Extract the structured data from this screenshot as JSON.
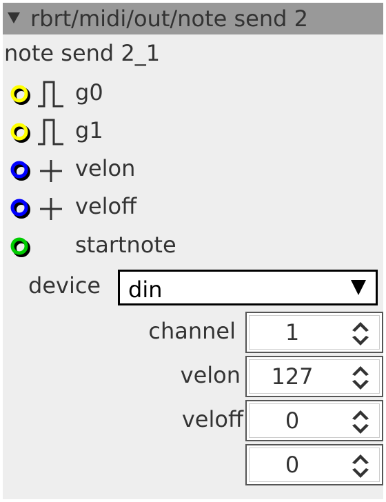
{
  "header": {
    "title": "rbrt/midi/out/note send 2",
    "collapse_icon": "triangle-down-icon"
  },
  "instance_name": "note send 2_1",
  "inlets": [
    {
      "label": "g0",
      "ring_color": "#ffff00",
      "symbol": "pulse-icon"
    },
    {
      "label": "g1",
      "ring_color": "#ffff00",
      "symbol": "pulse-icon"
    },
    {
      "label": "velon",
      "ring_color": "#0000ff",
      "symbol": "plus-icon"
    },
    {
      "label": "veloff",
      "ring_color": "#0000ff",
      "symbol": "plus-icon"
    },
    {
      "label": "startnote",
      "ring_color": "#00cc00",
      "symbol": ""
    }
  ],
  "device": {
    "label": "device",
    "value": "din"
  },
  "params": [
    {
      "label": "channel",
      "value": "1"
    },
    {
      "label": "velon",
      "value": "127"
    },
    {
      "label": "veloff",
      "value": "0"
    },
    {
      "label": "",
      "value": "0"
    }
  ]
}
